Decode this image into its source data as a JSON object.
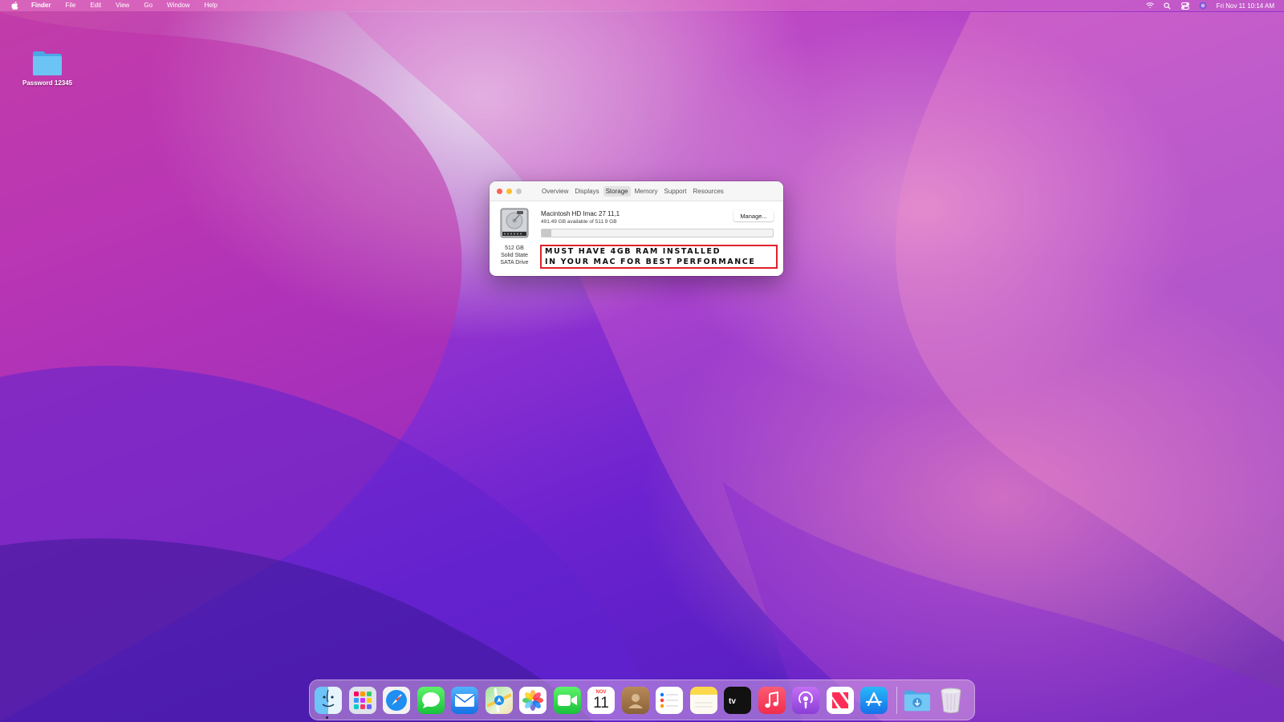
{
  "menubar": {
    "app_name": "Finder",
    "menus": [
      "File",
      "Edit",
      "View",
      "Go",
      "Window",
      "Help"
    ],
    "clock": "Fri Nov 11  10:14 AM"
  },
  "desktop": {
    "folder_label": "Password 12345"
  },
  "window": {
    "tabs": [
      "Overview",
      "Displays",
      "Storage",
      "Memory",
      "Support",
      "Resources"
    ],
    "active_tab": "Storage",
    "disk": {
      "size": "512 GB",
      "type": "Solid State",
      "interface": "SATA Drive"
    },
    "volume_name": "Macintosh HD Imac 27 11,1",
    "available_text": "491.49 GB available of 511.9 GB",
    "manage_label": "Manage...",
    "used_fraction": 0.04,
    "warning": {
      "line1": "MUST HAVE 4GB RAM INSTALLED",
      "line2": "IN YOUR MAC FOR BEST PERFORMANCE"
    }
  },
  "dock": {
    "items": [
      "finder-icon",
      "launchpad-icon",
      "safari-icon",
      "messages-icon",
      "mail-icon",
      "maps-icon",
      "photos-icon",
      "facetime-icon",
      "calendar-icon",
      "contacts-icon",
      "reminders-icon",
      "notes-icon",
      "apple-tv-icon",
      "music-icon",
      "podcasts-icon",
      "news-icon",
      "app-store-icon",
      "downloads-icon",
      "trash-icon"
    ],
    "calendar_month": "NOV",
    "calendar_day": "11"
  },
  "colors": {
    "warning_border": "#e0222a",
    "close": "#ff5f57",
    "minimize": "#febc2e",
    "zoom": "#c8c8c8"
  }
}
